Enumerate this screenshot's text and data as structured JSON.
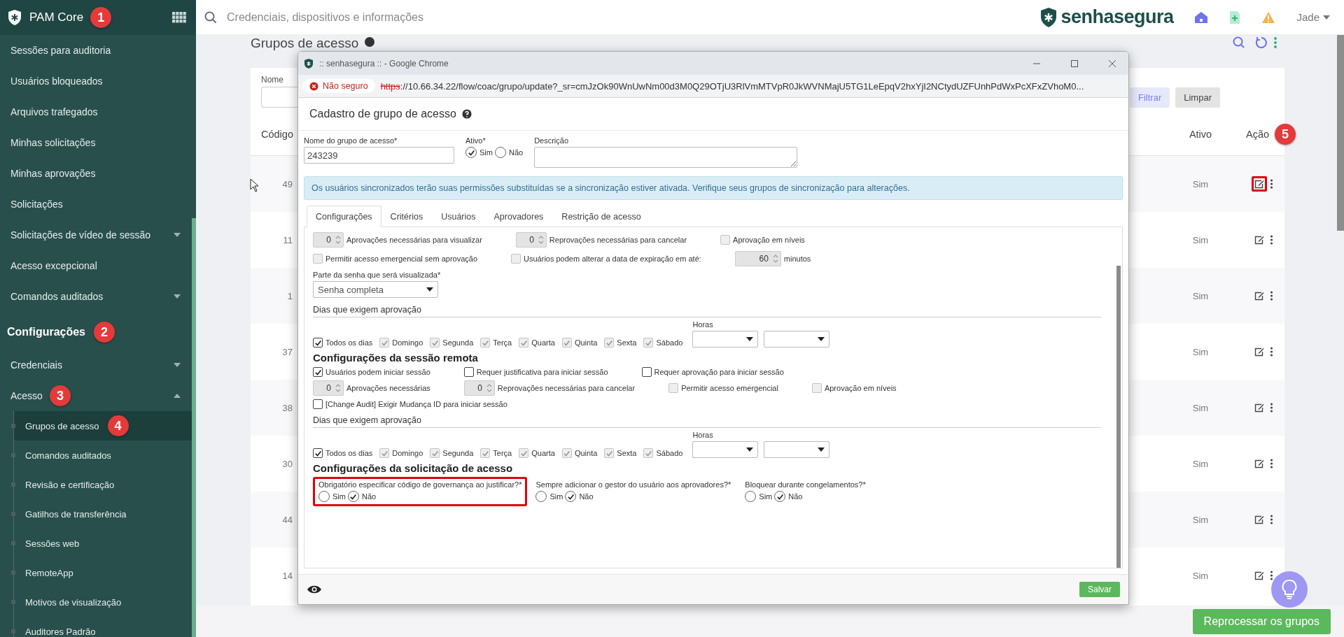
{
  "header": {
    "brand": "PAM Core",
    "brand_badge": "1",
    "search": {
      "placeholder": "Credenciais, dispositivos e informações"
    },
    "logo": "senhasegura",
    "user": "Jade"
  },
  "sidebar": {
    "items": [
      {
        "label": "Sessões para auditoria",
        "kind": "link",
        "selected": false
      },
      {
        "label": "Usuários bloqueados",
        "kind": "link",
        "selected": false
      },
      {
        "label": "Arquivos trafegados",
        "kind": "link",
        "selected": false
      },
      {
        "label": "Minhas solicitações",
        "kind": "link",
        "selected": false
      },
      {
        "label": "Minhas aprovações",
        "kind": "link",
        "selected": false
      },
      {
        "label": "Solicitações",
        "kind": "link",
        "selected": false
      },
      {
        "label": "Solicitações de vídeo de sessão",
        "kind": "dropdown",
        "expanded": false,
        "selected": false
      },
      {
        "label": "Acesso excepcional",
        "kind": "link",
        "selected": false
      },
      {
        "label": "Comandos auditados",
        "kind": "dropdown",
        "expanded": false,
        "selected": false
      },
      {
        "label": "Configurações",
        "kind": "section",
        "badge": "2"
      },
      {
        "label": "Credenciais",
        "kind": "dropdown",
        "expanded": false,
        "selected": false
      },
      {
        "label": "Acesso",
        "kind": "dropdown",
        "expanded": true,
        "selected": false,
        "badge": "3",
        "children": [
          {
            "label": "Grupos de acesso",
            "selected": true,
            "badge": "4"
          },
          {
            "label": "Comandos auditados",
            "selected": false
          },
          {
            "label": "Revisão e certificação",
            "selected": false
          },
          {
            "label": "Gatilhos de transferência",
            "selected": false
          },
          {
            "label": "Sessões web",
            "selected": false
          },
          {
            "label": "RemoteApp",
            "selected": false
          },
          {
            "label": "Motivos de visualização",
            "selected": false
          },
          {
            "label": "Auditores Padrão",
            "selected": false
          }
        ]
      }
    ]
  },
  "page": {
    "title": "Grupos de acesso",
    "filter": {
      "label": "Nome",
      "buttons": [
        {
          "label": "Filtrar",
          "kind": "primary"
        },
        {
          "label": "Limpar",
          "kind": "secondary"
        }
      ]
    },
    "table": {
      "columns": [
        {
          "label": "Código"
        },
        {
          "label": "Ativo"
        },
        {
          "label": "Ação",
          "badge": "5"
        }
      ],
      "rows": [
        {
          "code": "49",
          "active": "Sim",
          "highlighted": true
        },
        {
          "code": "11",
          "active": "Sim",
          "highlighted": false
        },
        {
          "code": "1",
          "active": "Sim",
          "highlighted": false
        },
        {
          "code": "37",
          "active": "Sim",
          "highlighted": false
        },
        {
          "code": "38",
          "active": "Sim",
          "highlighted": false
        },
        {
          "code": "30",
          "active": "Sim",
          "highlighted": false
        },
        {
          "code": "44",
          "active": "Sim",
          "highlighted": false
        },
        {
          "code": "14",
          "active": "Sim",
          "highlighted": false
        }
      ]
    },
    "reprocess_button": "Reprocessar os grupos"
  },
  "popup": {
    "window_title": ":: senhasegura :: - Google Chrome",
    "security_label": "Não seguro",
    "url_scheme": "https",
    "url_rest": "://10.66.34.22/flow/coac/grupo/update?_sr=cmJzOk90WnUwNm00d3M0Q29OTjU3RlVmMTVpR0JkWVNMajU5TG1LeEpqV2hxYjI2NCtydUZFUnhPdWxPcXFxZVhoM0...",
    "form_title": "Cadastro de grupo de acesso",
    "name_field": {
      "label": "Nome do grupo de acesso*",
      "value": "243239"
    },
    "active_field": {
      "label": "Ativo*",
      "options": [
        {
          "label": "Sim",
          "selected": true
        },
        {
          "label": "Não",
          "selected": false
        }
      ]
    },
    "description_field": {
      "label": "Descrição"
    },
    "alert": "Os usuários sincronizados terão suas permissões substituídas se a sincronização estiver ativada. Verifique seus grupos de sincronização para alterações.",
    "tabs": [
      {
        "label": "Configurações",
        "selected": true
      },
      {
        "label": "Critérios",
        "selected": false
      },
      {
        "label": "Usuários",
        "selected": false
      },
      {
        "label": "Aprovadores",
        "selected": false
      },
      {
        "label": "Restrição de acesso",
        "selected": false
      }
    ],
    "panel": [
      {
        "kind": "controls",
        "items": [
          {
            "kind": "spinner",
            "value": "0",
            "label": "Aprovações necessárias para visualizar"
          },
          {
            "kind": "spinner",
            "value": "0",
            "label": "Reprovações necessárias para cancelar"
          },
          {
            "kind": "checkbox",
            "label": "Aprovação em níveis",
            "checked": false,
            "disabled": true
          }
        ]
      },
      {
        "kind": "controls",
        "items": [
          {
            "kind": "checkbox",
            "label": "Permitir acesso emergencial sem aprovação",
            "checked": false,
            "disabled": true
          },
          {
            "kind": "checkbox",
            "label": "Usuários podem alterar a data de expiração em até:",
            "checked": false,
            "disabled": true
          },
          {
            "kind": "spinner",
            "value": "60",
            "label": "minutos"
          }
        ]
      },
      {
        "kind": "select",
        "label": "Parte da senha que será visualizada*",
        "value": "Senha completa"
      },
      {
        "kind": "subheading",
        "text": "Dias que exigem aprovação"
      },
      {
        "kind": "days",
        "hours_label": "Horas",
        "days": [
          {
            "label": "Todos os dias",
            "checked": true,
            "disabled": false
          },
          {
            "label": "Domingo",
            "checked": true,
            "disabled": true
          },
          {
            "label": "Segunda",
            "checked": true,
            "disabled": true
          },
          {
            "label": "Terça",
            "checked": true,
            "disabled": true
          },
          {
            "label": "Quarta",
            "checked": true,
            "disabled": true
          },
          {
            "label": "Quinta",
            "checked": true,
            "disabled": true
          },
          {
            "label": "Sexta",
            "checked": true,
            "disabled": true
          },
          {
            "label": "Sábado",
            "checked": true,
            "disabled": true
          }
        ]
      },
      {
        "kind": "heading",
        "text": "Configurações da sessão remota"
      },
      {
        "kind": "controls",
        "items": [
          {
            "kind": "checkbox",
            "label": "Usuários podem iniciar sessão",
            "checked": true,
            "disabled": false
          },
          {
            "kind": "checkbox",
            "label": "Requer justificativa para iniciar sessão",
            "checked": false,
            "disabled": false
          },
          {
            "kind": "checkbox",
            "label": "Requer aprovação para iniciar sessão",
            "checked": false,
            "disabled": false
          }
        ]
      },
      {
        "kind": "controls",
        "items": [
          {
            "kind": "spinner",
            "value": "0",
            "label": "Aprovações necessárias"
          },
          {
            "kind": "spinner",
            "value": "0",
            "label": "Reprovações necessárias para cancelar"
          },
          {
            "kind": "checkbox",
            "label": "Permitir acesso emergencial",
            "checked": false,
            "disabled": true
          },
          {
            "kind": "checkbox",
            "label": "Aprovação em níveis",
            "checked": false,
            "disabled": true
          }
        ]
      },
      {
        "kind": "controls",
        "items": [
          {
            "kind": "checkbox",
            "label": "[Change Audit] Exigir Mudança ID para iniciar sessão",
            "checked": false,
            "disabled": false
          }
        ]
      },
      {
        "kind": "subheading",
        "text": "Dias que exigem aprovação"
      },
      {
        "kind": "days",
        "hours_label": "Horas",
        "days": [
          {
            "label": "Todos os dias",
            "checked": true,
            "disabled": false
          },
          {
            "label": "Domingo",
            "checked": true,
            "disabled": true
          },
          {
            "label": "Segunda",
            "checked": true,
            "disabled": true
          },
          {
            "label": "Terça",
            "checked": true,
            "disabled": true
          },
          {
            "label": "Quarta",
            "checked": true,
            "disabled": true
          },
          {
            "label": "Quinta",
            "checked": true,
            "disabled": true
          },
          {
            "label": "Sexta",
            "checked": true,
            "disabled": true
          },
          {
            "label": "Sábado",
            "checked": true,
            "disabled": true
          }
        ]
      },
      {
        "kind": "heading",
        "text": "Configurações da solicitação de acesso"
      },
      {
        "kind": "questions",
        "items": [
          {
            "label": "Obrigatório especificar código de governança ao justificar?*",
            "highlighted": true,
            "options": [
              {
                "label": "Sim",
                "selected": false
              },
              {
                "label": "Não",
                "selected": true
              }
            ]
          },
          {
            "label": "Sempre adicionar o gestor do usuário aos aprovadores?*",
            "highlighted": false,
            "options": [
              {
                "label": "Sim",
                "selected": false
              },
              {
                "label": "Não",
                "selected": true
              }
            ]
          },
          {
            "label": "Bloquear durante congelamentos?*",
            "highlighted": false,
            "options": [
              {
                "label": "Sim",
                "selected": false
              },
              {
                "label": "Não",
                "selected": true
              }
            ]
          }
        ]
      }
    ],
    "save_button": "Salvar"
  }
}
